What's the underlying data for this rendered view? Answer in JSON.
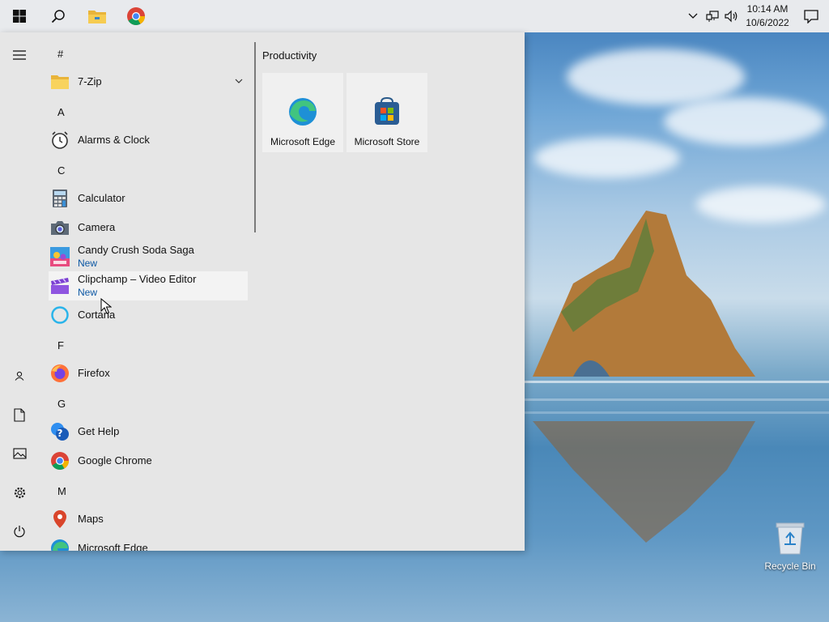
{
  "taskbar": {
    "clock_time": "10:14 AM",
    "clock_date": "10/6/2022",
    "pinned": [
      "windows-start",
      "search",
      "file-explorer",
      "google-chrome"
    ]
  },
  "start_menu": {
    "letters": {
      "hash": "#",
      "a": "A",
      "c": "C",
      "f": "F",
      "g": "G",
      "m": "M"
    },
    "apps": {
      "zip": "7-Zip",
      "alarms": "Alarms & Clock",
      "calculator": "Calculator",
      "camera": "Camera",
      "candy": "Candy Crush Soda Saga",
      "clipchamp": "Clipchamp – Video Editor",
      "cortana": "Cortana",
      "firefox": "Firefox",
      "gethelp": "Get Help",
      "chrome": "Google Chrome",
      "maps": "Maps",
      "edge": "Microsoft Edge"
    },
    "new_badge": "New",
    "tiles_group": "Productivity",
    "tiles": {
      "edge": "Microsoft Edge",
      "store": "Microsoft Store"
    }
  },
  "desktop": {
    "recycle_bin": "Recycle Bin"
  },
  "colors": {
    "accent_new": "#0b57a4",
    "menu_bg": "#e6e6e6",
    "taskbar_bg": "#e8eaed"
  }
}
